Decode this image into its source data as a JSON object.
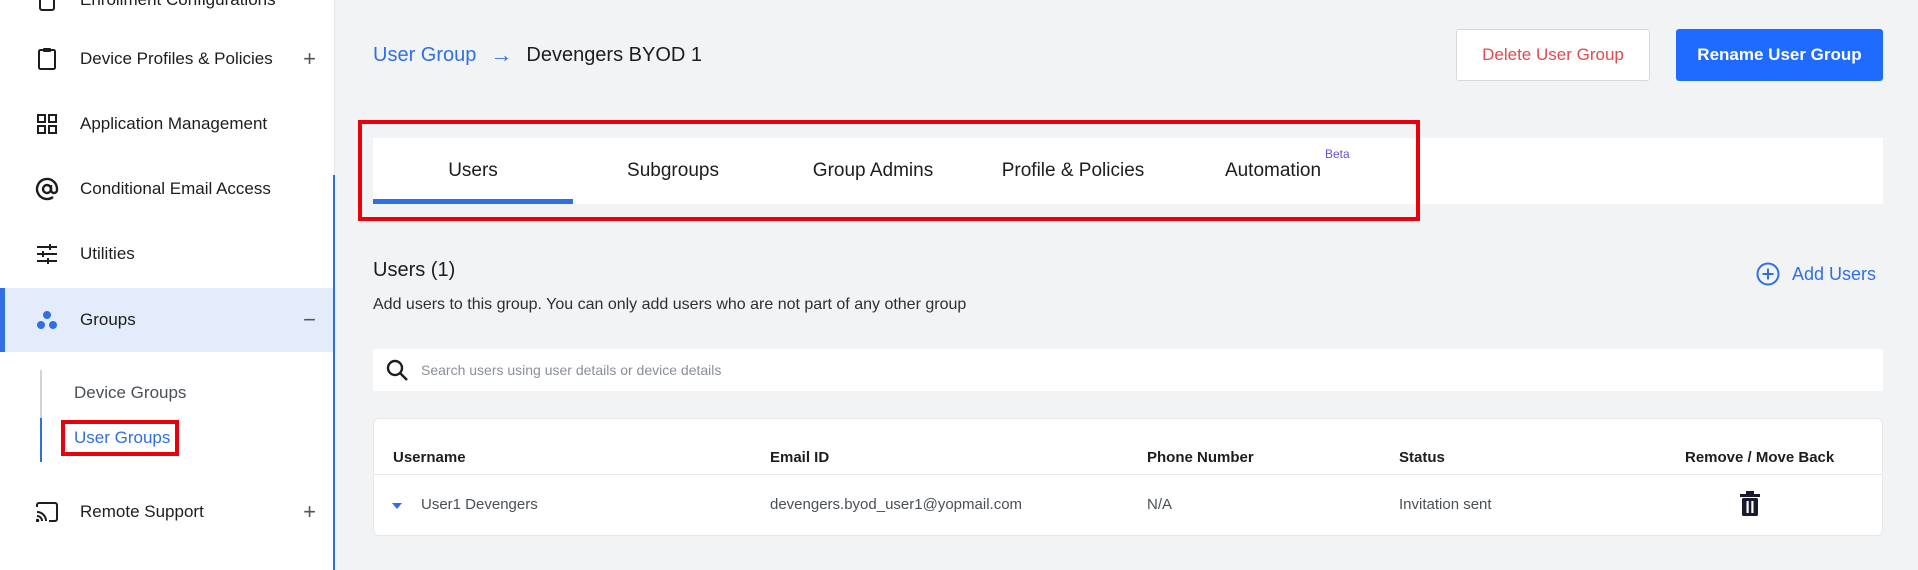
{
  "sidebar": {
    "items": [
      {
        "label": "Enrollment Configurations",
        "icon": "device-icon"
      },
      {
        "label": "Device Profiles & Policies",
        "icon": "clipboard-icon",
        "expander": "+"
      },
      {
        "label": "Application Management",
        "icon": "grid-icon"
      },
      {
        "label": "Conditional Email Access",
        "icon": "at-icon"
      },
      {
        "label": "Utilities",
        "icon": "sliders-icon"
      },
      {
        "label": "Groups",
        "icon": "groups-icon",
        "expander": "−"
      },
      {
        "label": "Remote Support",
        "icon": "cast-icon",
        "expander": "+"
      }
    ],
    "subitems": [
      {
        "label": "Device Groups"
      },
      {
        "label": "User Groups"
      }
    ]
  },
  "breadcrumb": {
    "parent": "User Group",
    "arrow": "→",
    "current": "Devengers BYOD 1"
  },
  "header": {
    "delete_label": "Delete User Group",
    "rename_label": "Rename User Group"
  },
  "tabs": [
    {
      "label": "Users"
    },
    {
      "label": "Subgroups"
    },
    {
      "label": "Group Admins"
    },
    {
      "label": "Profile & Policies"
    },
    {
      "label": "Automation",
      "badge": "Beta"
    }
  ],
  "users": {
    "title": "Users (1)",
    "description": "Add users to this group. You can only add users who are not part of any other group",
    "add_label": "Add Users",
    "search_placeholder": "Search users using user details or device details",
    "columns": [
      "Username",
      "Email ID",
      "Phone Number",
      "Status",
      "Remove / Move Back"
    ],
    "rows": [
      {
        "username": "User1 Devengers",
        "email": "devengers.byod_user1@yopmail.com",
        "phone": "N/A",
        "status": "Invitation sent"
      }
    ]
  },
  "colors": {
    "accent": "#2f6fe4",
    "primary_button": "#1f6bff",
    "danger": "#e5484d",
    "highlight": "#e8000b",
    "beta": "#6b4fd8"
  }
}
